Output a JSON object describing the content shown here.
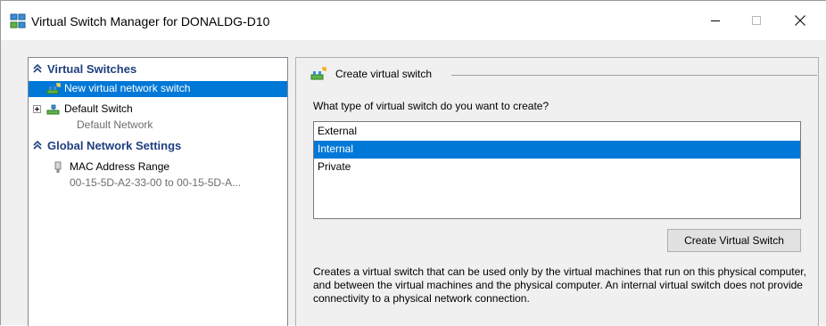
{
  "window": {
    "title": "Virtual Switch Manager for DONALDG-D10",
    "icon": "virtual-switch-manager-icon",
    "controls": {
      "minimize": "minimize-icon",
      "maximize": "maximize-icon",
      "close": "close-icon"
    }
  },
  "tree": {
    "virtual_switches": {
      "header": "Virtual Switches",
      "new_switch": "New virtual network switch",
      "default_switch": {
        "label": "Default Switch",
        "detail": "Default Network"
      }
    },
    "global_settings": {
      "header": "Global Network Settings",
      "mac_range": {
        "label": "MAC Address Range",
        "detail": "00-15-5D-A2-33-00 to 00-15-5D-A..."
      }
    }
  },
  "create": {
    "heading": "Create virtual switch",
    "question": "What type of virtual switch do you want to create?",
    "types": [
      "External",
      "Internal",
      "Private"
    ],
    "selected_type": "Internal",
    "button_label": "Create Virtual Switch",
    "description": "Creates a virtual switch that can be used only by the virtual machines that run on this physical computer, and between the virtual machines and the physical computer. An internal virtual switch does not provide connectivity to a physical network connection."
  },
  "colors": {
    "selection": "#0078d7",
    "header_text": "#1f3f7f",
    "muted_text": "#6d6d6d"
  }
}
